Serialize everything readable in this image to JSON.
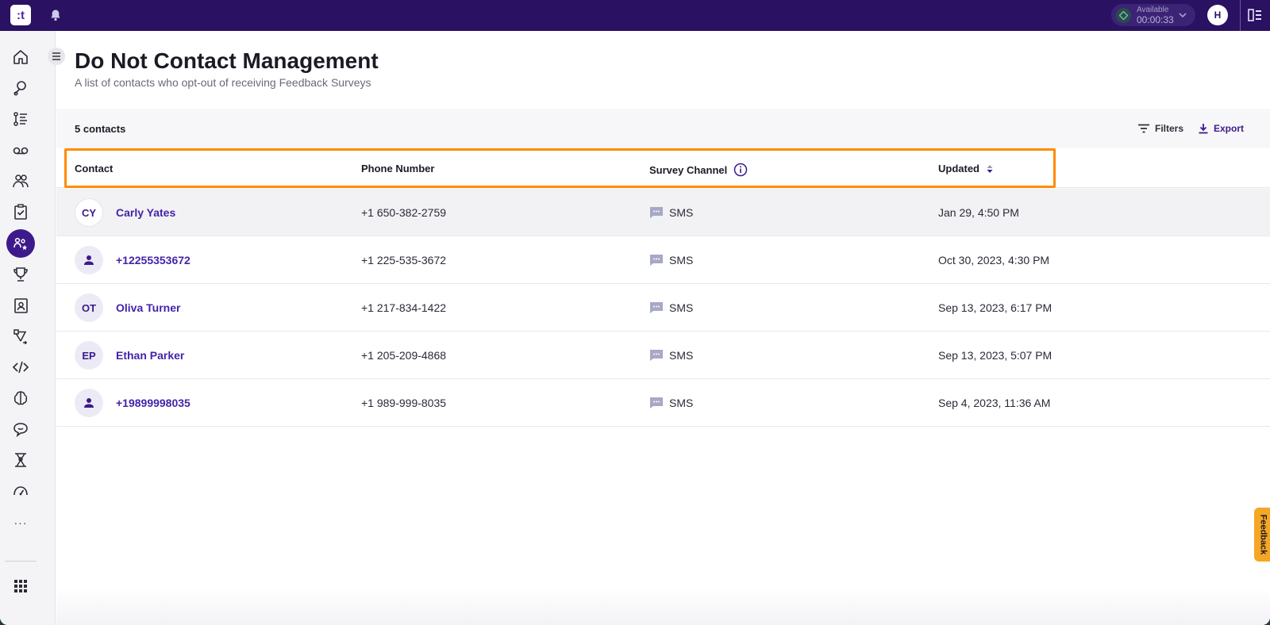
{
  "topbar": {
    "logo_text": ":t",
    "status_label": "Available",
    "status_timer": "00:00:33",
    "user_initial": "H"
  },
  "sidenav": {
    "items": [
      "home",
      "inbox",
      "queue",
      "voicemail",
      "team",
      "tasks",
      "do-not-contact",
      "trophy",
      "contacts",
      "workflows",
      "developer",
      "ai",
      "conversations",
      "training",
      "analytics"
    ],
    "more": "···"
  },
  "header": {
    "title": "Do Not Contact Management",
    "subtitle": "A list of contacts who opt-out of receiving Feedback Surveys"
  },
  "toolbar": {
    "count": "5 contacts",
    "filters_label": "Filters",
    "export_label": "Export"
  },
  "table": {
    "columns": {
      "contact": "Contact",
      "phone": "Phone Number",
      "channel": "Survey Channel",
      "updated": "Updated"
    },
    "rows": [
      {
        "initials": "CY",
        "name": "Carly Yates",
        "phone": "+1 650-382-2759",
        "channel": "SMS",
        "updated": "Jan 29, 4:50 PM"
      },
      {
        "initials": "",
        "name": "+12255353672",
        "phone": "+1 225-535-3672",
        "channel": "SMS",
        "updated": "Oct 30, 2023, 4:30 PM"
      },
      {
        "initials": "OT",
        "name": "Oliva Turner",
        "phone": "+1 217-834-1422",
        "channel": "SMS",
        "updated": "Sep 13, 2023, 6:17 PM"
      },
      {
        "initials": "EP",
        "name": "Ethan Parker",
        "phone": "+1 205-209-4868",
        "channel": "SMS",
        "updated": "Sep 13, 2023, 5:07 PM"
      },
      {
        "initials": "",
        "name": "+19899998035",
        "phone": "+1 989-999-8035",
        "channel": "SMS",
        "updated": "Sep 4, 2023, 11:36 AM"
      }
    ]
  },
  "feedback_tab": "Feedback",
  "colors": {
    "topbar": "#2a1161",
    "accent": "#3d1a8c",
    "highlight": "#ff8c00",
    "feedback": "#f5a623"
  }
}
